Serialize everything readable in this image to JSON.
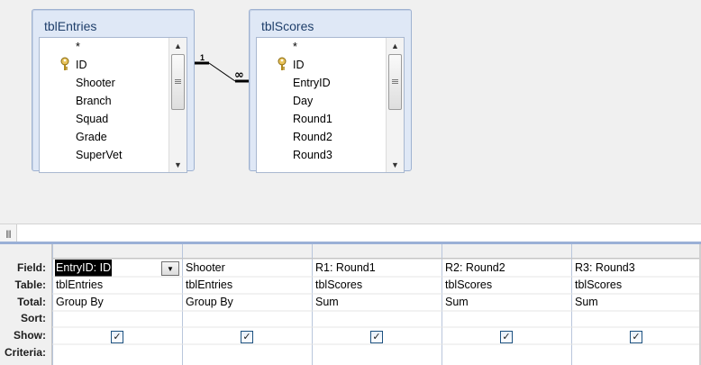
{
  "relationship_pane": {
    "tables": [
      {
        "title": "tblEntries",
        "fields": [
          "*",
          "ID",
          "Shooter",
          "Branch",
          "Squad",
          "Grade",
          "SuperVet"
        ]
      },
      {
        "title": "tblScores",
        "fields": [
          "*",
          "ID",
          "EntryID",
          "Day",
          "Round1",
          "Round2",
          "Round3"
        ]
      }
    ],
    "join": {
      "one_label": "1",
      "many_label": "∞"
    }
  },
  "grid": {
    "row_labels": [
      "Field:",
      "Table:",
      "Total:",
      "Sort:",
      "Show:",
      "Criteria:"
    ],
    "columns": [
      {
        "field": "EntryID: ID",
        "table": "tblEntries",
        "total": "Group By",
        "sort": "",
        "show": true
      },
      {
        "field": "Shooter",
        "table": "tblEntries",
        "total": "Group By",
        "sort": "",
        "show": true
      },
      {
        "field": "R1: Round1",
        "table": "tblScores",
        "total": "Sum",
        "sort": "",
        "show": true
      },
      {
        "field": "R2: Round2",
        "table": "tblScores",
        "total": "Sum",
        "sort": "",
        "show": true
      },
      {
        "field": "R3: Round3",
        "table": "tblScores",
        "total": "Sum",
        "sort": "",
        "show": true
      }
    ]
  },
  "colors": {
    "table_box_bg": "#dfe8f6",
    "table_title": "#1f3f6b",
    "selection": "#000000"
  }
}
